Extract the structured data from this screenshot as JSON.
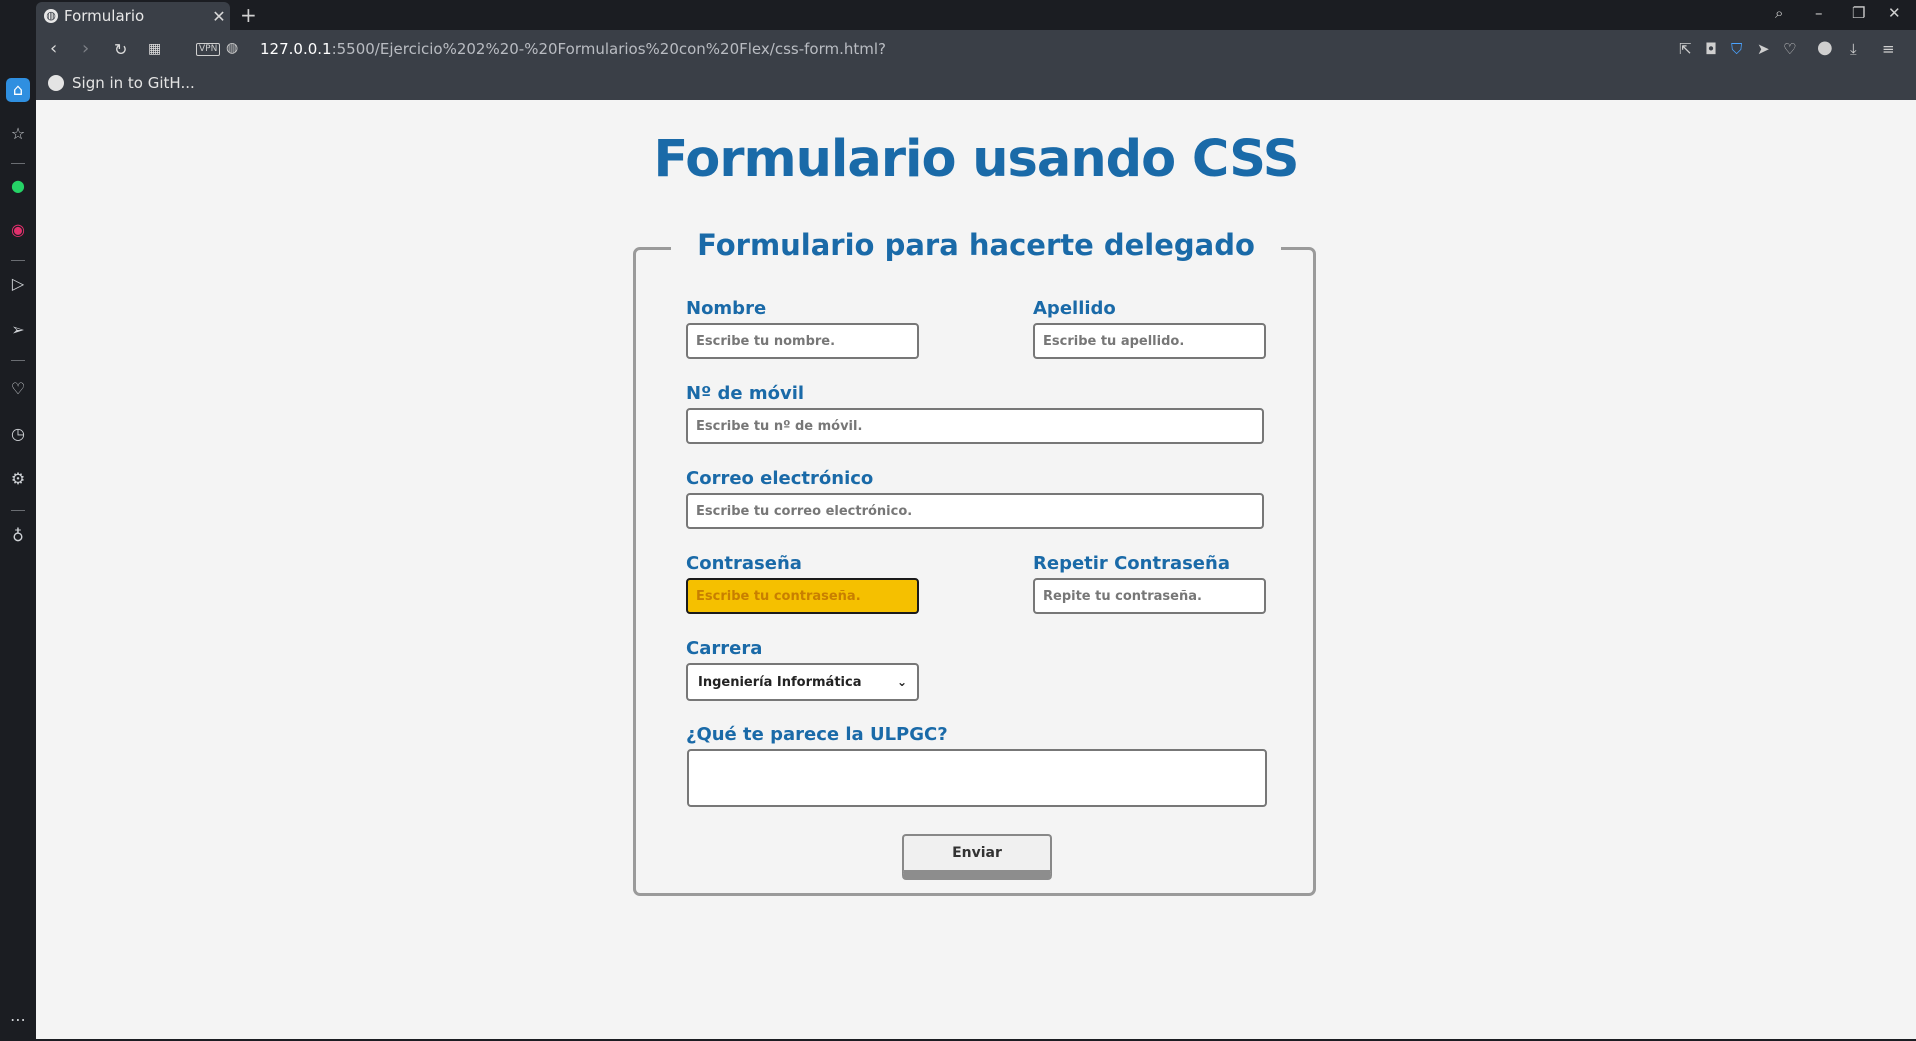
{
  "browser": {
    "tab_title": "Formulario",
    "tab_close": "✕",
    "new_tab": "+",
    "url_host": "127.0.0.1",
    "url_path": ":5500/Ejercicio%202%20-%20Formularios%20con%20Flex/css-form.html?",
    "vpn_label": "VPN",
    "bookmark_label": "Sign in to GitH..."
  },
  "icons": {
    "tab_favicon": "globe-icon",
    "back": "back-arrow-icon",
    "forward": "forward-arrow-icon",
    "reload": "reload-icon",
    "tabs_grid": "grid-icon",
    "security": "globe-icon",
    "share": "share-icon",
    "snapshot": "camera-icon",
    "shield": "shield-icon",
    "send": "send-icon",
    "heart": "heart-icon",
    "profile": "user-icon",
    "download": "download-icon",
    "menu": "menu-icon",
    "search": "search-icon"
  },
  "page": {
    "title": "Formulario usando CSS",
    "legend": "Formulario para hacerte delegado"
  },
  "form": {
    "nombre_label": "Nombre",
    "nombre_placeholder": "Escribe tu nombre.",
    "apellido_label": "Apellido",
    "apellido_placeholder": "Escribe tu apellido.",
    "movil_label": "Nº de móvil",
    "movil_placeholder": "Escribe tu nº de móvil.",
    "correo_label": "Correo electrónico",
    "correo_placeholder": "Escribe tu correo electrónico.",
    "password_label": "Contraseña",
    "password_placeholder": "Escribe tu contraseña.",
    "repeat_label": "Repetir Contraseña",
    "repeat_placeholder": "Repite tu contraseña.",
    "carrera_label": "Carrera",
    "carrera_selected": "Ingeniería Informática",
    "opinion_label": "¿Qué te parece la ULPGC?",
    "submit_label": "Enviar"
  },
  "colors": {
    "accent": "#1a6aa8",
    "focused_field": "#f5c000",
    "chrome_dark": "#1b1d22",
    "chrome_toolbar": "#3a3f47"
  }
}
